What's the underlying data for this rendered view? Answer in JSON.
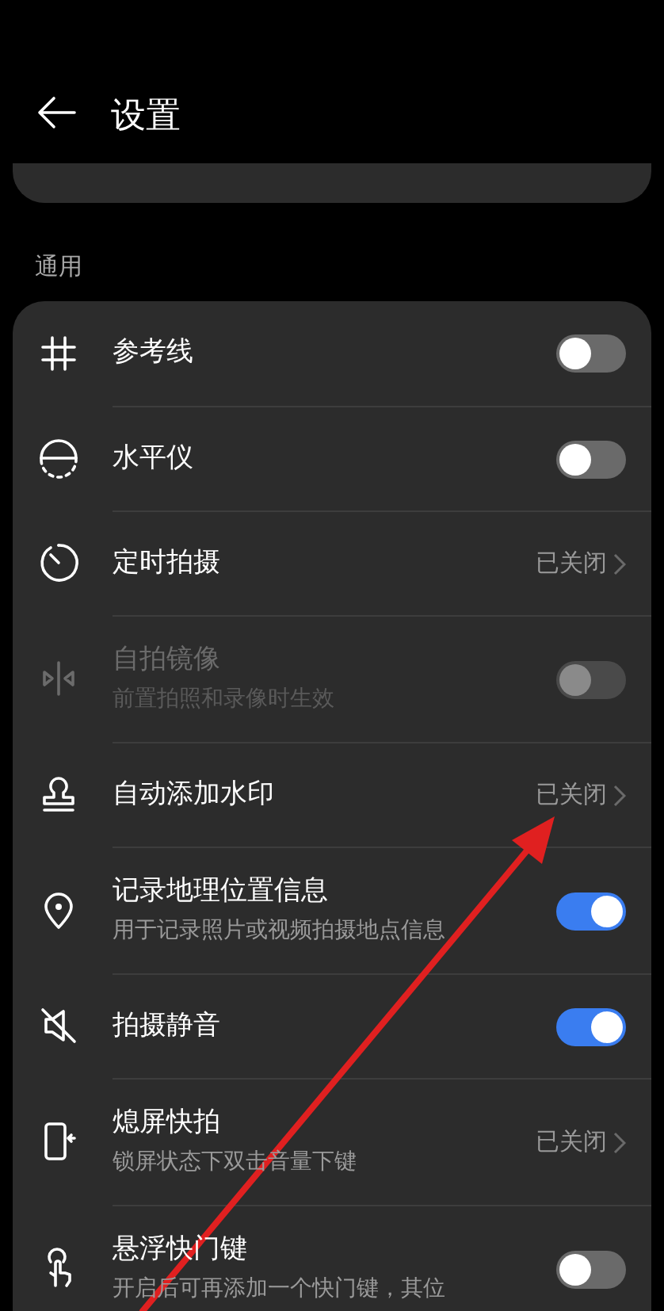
{
  "header": {
    "title": "设置"
  },
  "section": {
    "title": "通用"
  },
  "rows": [
    {
      "kind": "toggle",
      "title": "参考线",
      "on": false,
      "disabled": false
    },
    {
      "kind": "toggle",
      "title": "水平仪",
      "on": false,
      "disabled": false
    },
    {
      "kind": "link",
      "title": "定时拍摄",
      "value": "已关闭"
    },
    {
      "kind": "toggle",
      "title": "自拍镜像",
      "subtitle": "前置拍照和录像时生效",
      "on": false,
      "disabled": true
    },
    {
      "kind": "link",
      "title": "自动添加水印",
      "value": "已关闭"
    },
    {
      "kind": "toggle",
      "title": "记录地理位置信息",
      "subtitle": "用于记录照片或视频拍摄地点信息",
      "on": true,
      "disabled": false
    },
    {
      "kind": "toggle",
      "title": "拍摄静音",
      "on": true,
      "disabled": false
    },
    {
      "kind": "link",
      "title": "熄屏快拍",
      "subtitle": "锁屏状态下双击音量下键",
      "value": "已关闭"
    },
    {
      "kind": "toggle",
      "title": "悬浮快门键",
      "subtitle": "开启后可再添加一个快门键，其位",
      "on": false,
      "disabled": false
    }
  ]
}
